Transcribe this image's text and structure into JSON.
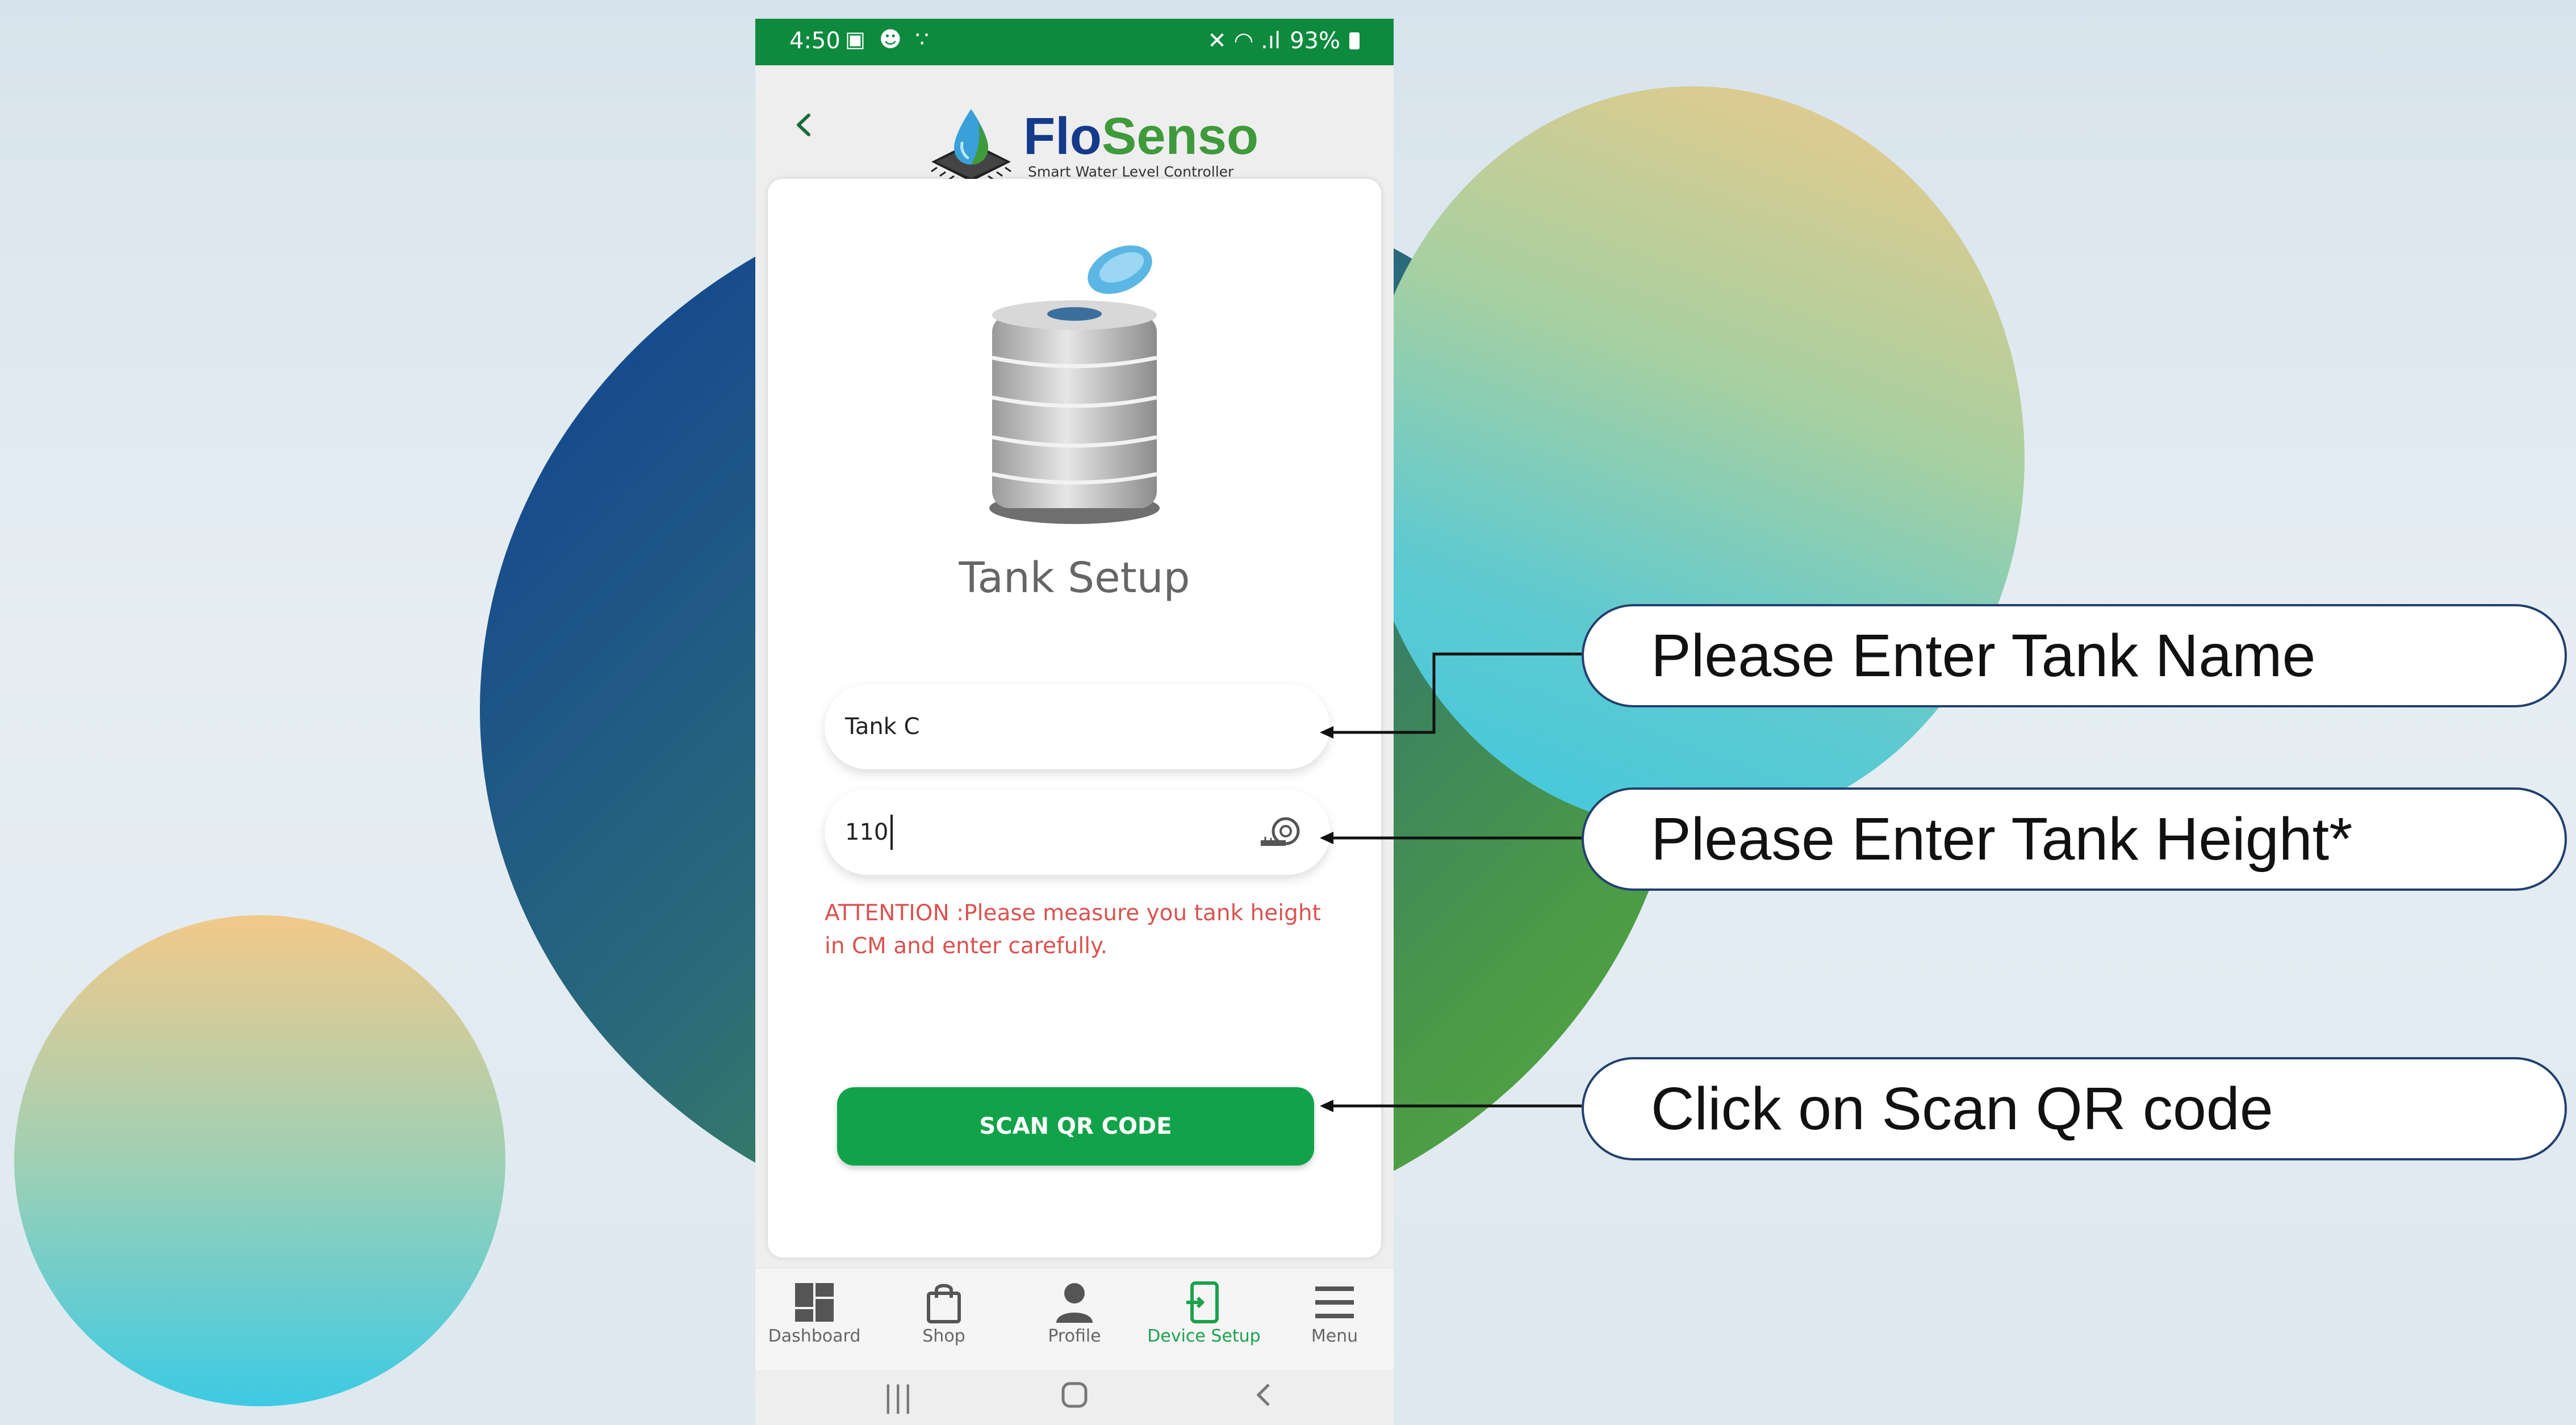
{
  "status_bar": {
    "time": "4:50",
    "left_icons": "▣ ☻ ∵",
    "right_icons": "✕ ◠ .ıl",
    "battery": "93%"
  },
  "header": {
    "brand_part1": "Flo",
    "brand_part2": "Senso",
    "tagline": "Smart Water Level Controller"
  },
  "screen": {
    "title": "Tank Setup",
    "tank_name_value": "Tank C",
    "tank_height_value": "110",
    "attention_text": "ATTENTION :Please measure you tank height in CM and enter carefully.",
    "scan_button": "SCAN QR CODE"
  },
  "bottom_nav": {
    "items": [
      {
        "label": "Dashboard",
        "icon": "dashboard-icon"
      },
      {
        "label": "Shop",
        "icon": "shopping-bag-icon"
      },
      {
        "label": "Profile",
        "icon": "person-icon"
      },
      {
        "label": "Device Setup",
        "icon": "device-setup-icon"
      },
      {
        "label": "Menu",
        "icon": "hamburger-menu-icon"
      }
    ],
    "active": "Device Setup"
  },
  "callouts": {
    "tank_name": "Please Enter Tank Name",
    "tank_height": "Please Enter Tank Height*",
    "scan_qr": "Click on Scan QR code"
  },
  "colors": {
    "status_bar": "#0e8a3e",
    "brand_blue": "#143a8a",
    "brand_green": "#3f9a3c",
    "scan_button": "#12a34a",
    "attention_red": "#d9534f",
    "active_nav": "#1aa24c"
  }
}
